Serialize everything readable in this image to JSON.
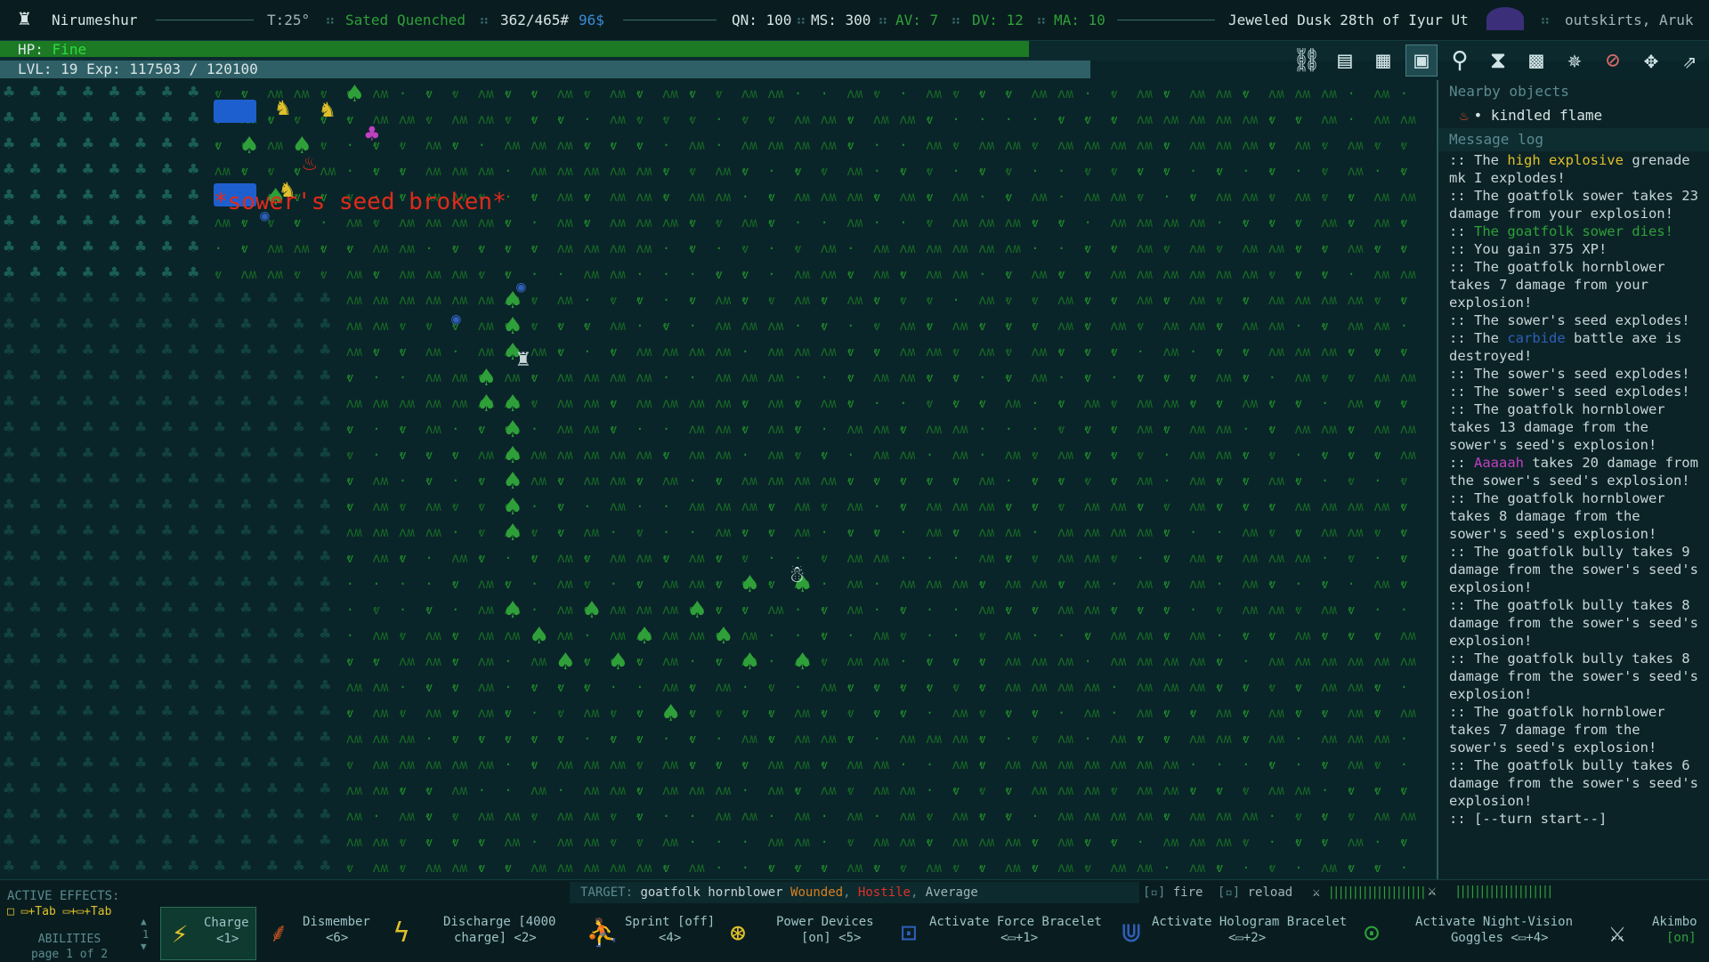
{
  "topbar": {
    "name": "Nirumeshur",
    "temperature": "T:25°",
    "status_sated": "Sated",
    "status_quenched": "Quenched",
    "weight": "362/465#",
    "money": "96$",
    "qn": "QN: 100",
    "ms": "MS: 300",
    "av": "AV: 7",
    "dv": "DV: 12",
    "ma": "MA: 10",
    "date": "Jeweled Dusk 28th of Iyur Ut",
    "location": "outskirts, Aruk"
  },
  "hp": {
    "label": "HP:",
    "status": "Fine",
    "fill_fraction": 0.602
  },
  "xp": {
    "text": "LVL: 19 Exp: 117503 / 120100",
    "fill_fraction": 0.978
  },
  "toolbar": {
    "icons": [
      "link-icon",
      "inventory-icon",
      "map-icon",
      "tiles-icon",
      "search-icon",
      "hourglass-icon",
      "character-icon",
      "star-icon",
      "compass-icon",
      "crosshair-icon",
      "leap-icon"
    ],
    "selected_index": 3
  },
  "map": {
    "floating_text": "*sower's seed broken*"
  },
  "side": {
    "nearby_header": "Nearby objects",
    "nearby_item": "• kindled flame",
    "log_header": "Message log",
    "log": [
      {
        "pre": ":: The ",
        "hl": "high explosive",
        "hlc": "y",
        "post": " grenade mk I explodes!"
      },
      {
        "pre": ":: The goatfolk sower takes 23 damage from your explosion!",
        "hl": "",
        "hlc": "",
        "post": ""
      },
      {
        "pre": ":: ",
        "hl": "The goatfolk sower dies!",
        "hlc": "g",
        "post": ""
      },
      {
        "pre": ":: You gain 375 XP!",
        "hl": "",
        "hlc": "",
        "post": ""
      },
      {
        "pre": ":: The goatfolk hornblower takes 7 damage from your explosion!",
        "hl": "",
        "hlc": "",
        "post": ""
      },
      {
        "pre": ":: The sower's seed explodes!",
        "hl": "",
        "hlc": "",
        "post": ""
      },
      {
        "pre": ":: The ",
        "hl": "carbide",
        "hlc": "b",
        "post": " battle axe is destroyed!"
      },
      {
        "pre": ":: The sower's seed explodes!",
        "hl": "",
        "hlc": "",
        "post": ""
      },
      {
        "pre": ":: The sower's seed explodes!",
        "hl": "",
        "hlc": "",
        "post": ""
      },
      {
        "pre": ":: The goatfolk hornblower takes 13 damage from the sower's seed's explosion!",
        "hl": "",
        "hlc": "",
        "post": ""
      },
      {
        "pre": ":: ",
        "hl": "Aaaaah",
        "hlc": "m",
        "post": " takes 20 damage from the sower's seed's explosion!"
      },
      {
        "pre": ":: The goatfolk hornblower takes 8 damage from the sower's seed's explosion!",
        "hl": "",
        "hlc": "",
        "post": ""
      },
      {
        "pre": ":: The goatfolk bully takes 9 damage from the sower's seed's explosion!",
        "hl": "",
        "hlc": "",
        "post": ""
      },
      {
        "pre": ":: The goatfolk bully takes 8 damage from the sower's seed's explosion!",
        "hl": "",
        "hlc": "",
        "post": ""
      },
      {
        "pre": ":: The goatfolk bully takes 8 damage from the sower's seed's explosion!",
        "hl": "",
        "hlc": "",
        "post": ""
      },
      {
        "pre": ":: The goatfolk hornblower takes 7 damage from the sower's seed's explosion!",
        "hl": "",
        "hlc": "",
        "post": ""
      },
      {
        "pre": ":: The goatfolk bully takes 6 damage from the sower's seed's explosion!",
        "hl": "",
        "hlc": "",
        "post": ""
      },
      {
        "pre": ":: [--turn start--]",
        "hl": "",
        "hlc": "",
        "post": ""
      }
    ]
  },
  "bottom": {
    "active_effects": "ACTIVE EFFECTS:",
    "target_label": "TARGET:",
    "target_name": "goatfolk hornblower",
    "target_wounded": "Wounded",
    "target_hostile": "Hostile",
    "target_average": "Average",
    "fire_key": "[▫]",
    "fire_label": "fire",
    "reload_key": "[▫]",
    "reload_label": "reload",
    "tab_hint1": "▭+Tab",
    "tab_hint2": "▭+▭+Tab",
    "abilities_label": "ABILITIES",
    "page_label": "page 1 of 2",
    "page_num": "1",
    "abilities": [
      {
        "name": "Charge",
        "key": "<1>"
      },
      {
        "name": "Dismember",
        "key": "<6>"
      },
      {
        "name": "Discharge [4000",
        "key": "charge] <2>"
      },
      {
        "name": "Sprint [off]",
        "key": "<4>"
      },
      {
        "name": "Power Devices",
        "key": "[on] <5>"
      },
      {
        "name": "Activate Force Bracelet",
        "key": "<▭+1>"
      },
      {
        "name": "Activate Hologram Bracelet",
        "key": "<▭+2>"
      },
      {
        "name": "Activate Night-Vision",
        "key": "Goggles <▭+4>"
      },
      {
        "name": "Akimbo",
        "key": "[on]"
      }
    ]
  },
  "colors": {
    "background": "#0a2529",
    "grass": "#1f8a2a",
    "hp_fill": "#1c7a24",
    "xp_fill": "#2f6067",
    "sated": "#2fa039",
    "money": "#3a8ad8",
    "damage_text": "#e02a1a"
  }
}
